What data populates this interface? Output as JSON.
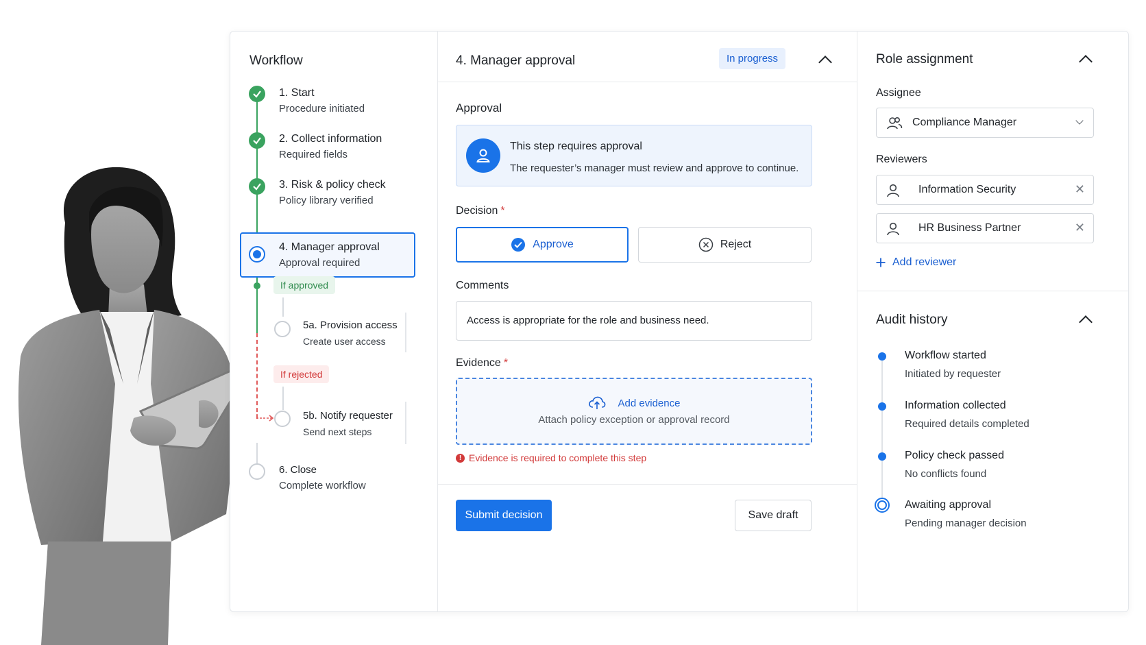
{
  "workflow": {
    "title": "Workflow",
    "steps": [
      {
        "title": "1. Start",
        "subtitle": "Procedure initiated",
        "state": "done"
      },
      {
        "title": "2. Collect information",
        "subtitle": "Required fields",
        "state": "done"
      },
      {
        "title": "3. Risk & policy check",
        "subtitle": "Policy library verified",
        "state": "done"
      },
      {
        "title": "4. Manager approval",
        "subtitle": "Approval required",
        "state": "current"
      },
      {
        "title": "5a. Provision access",
        "subtitle": "Create user access",
        "state": "pending"
      },
      {
        "title": "5b. Notify requester",
        "subtitle": "Send next steps",
        "state": "pending"
      },
      {
        "title": "6. Close",
        "subtitle": "Complete workflow",
        "state": "pending"
      }
    ],
    "branch_approved": "If approved",
    "branch_rejected": "If rejected"
  },
  "step_panel": {
    "title": "4. Manager approval",
    "status": "In progress",
    "approval_heading": "Approval",
    "info_title": "This step requires approval",
    "info_desc": "The requester’s manager must review and approve to continue.",
    "decision_label": "Decision",
    "required_mark": "*",
    "approve_label": "Approve",
    "reject_label": "Reject",
    "comments_label": "Comments",
    "comments_value": "Access is appropriate for the role and business need.",
    "evidence_label": "Evidence",
    "evidence_title": "Add evidence",
    "evidence_sub": "Attach policy exception or approval record",
    "error_text": "Evidence is required to complete this step",
    "submit_label": "Submit decision",
    "draft_label": "Save draft"
  },
  "role_assignment": {
    "title": "Role assignment",
    "assignee_label": "Assignee",
    "assignee_value": "Compliance Manager",
    "reviewers_label": "Reviewers",
    "reviewers": [
      "Information Security",
      "HR Business Partner"
    ],
    "add_reviewer": "Add reviewer"
  },
  "audit_history": {
    "title": "Audit history",
    "events": [
      {
        "title": "Workflow started",
        "subtitle": "Initiated by requester"
      },
      {
        "title": "Information collected",
        "subtitle": "Required details completed"
      },
      {
        "title": "Policy check passed",
        "subtitle": "No conflicts found"
      },
      {
        "title": "Awaiting approval",
        "subtitle": "Pending manager decision"
      }
    ]
  },
  "colors": {
    "accent": "#1a73e8",
    "success": "#3aa35f",
    "danger": "#d23a3a"
  },
  "icons": {
    "done": "check-icon",
    "assignee": "group-icon",
    "reviewer": "user-icon",
    "remove": "close-icon",
    "upload": "cloud-upload-icon",
    "collapse": "chevron-up-icon"
  }
}
